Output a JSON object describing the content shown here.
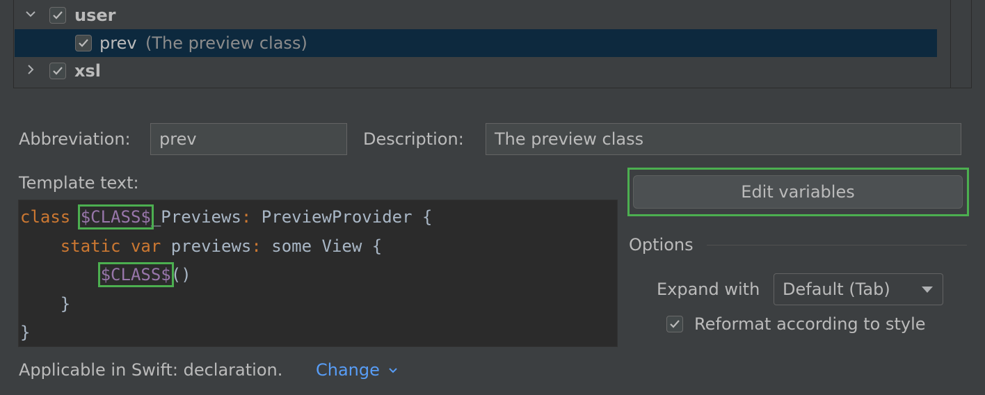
{
  "tree": {
    "rows": [
      {
        "label": "user",
        "checked": true,
        "expanded": true,
        "description": ""
      },
      {
        "label": "prev",
        "checked": true,
        "description": "(The preview class)",
        "selected": true
      },
      {
        "label": "xsl",
        "checked": true,
        "expanded": false,
        "description": ""
      }
    ]
  },
  "form": {
    "abbreviation_label": "Abbreviation:",
    "abbreviation_value": "prev",
    "description_label": "Description:",
    "description_value": "The preview class",
    "template_text_label": "Template text:"
  },
  "template": {
    "lines": [
      {
        "indent": "",
        "tokens": [
          [
            "kw",
            "class "
          ],
          [
            "var",
            "$CLASS$"
          ],
          [
            "plain",
            "_Previews"
          ],
          [
            "kw",
            ":"
          ],
          [
            "plain",
            " PreviewProvider {"
          ]
        ]
      },
      {
        "indent": "    ",
        "tokens": [
          [
            "kw",
            "static var "
          ],
          [
            "plain",
            "previews"
          ],
          [
            "kw",
            ":"
          ],
          [
            "plain",
            " some View {"
          ]
        ]
      },
      {
        "indent": "        ",
        "tokens": [
          [
            "var",
            "$CLASS$"
          ],
          [
            "plain",
            "()"
          ]
        ]
      },
      {
        "indent": "    ",
        "tokens": [
          [
            "plain",
            "}"
          ]
        ]
      },
      {
        "indent": "",
        "tokens": [
          [
            "plain",
            "}"
          ]
        ]
      }
    ]
  },
  "right_panel": {
    "edit_variables_label": "Edit variables",
    "options_label": "Options",
    "expand_with_label": "Expand with",
    "expand_with_value": "Default (Tab)",
    "reformat_label": "Reformat according to style",
    "reformat_checked": true
  },
  "footer": {
    "applicable_text": "Applicable in Swift: declaration.",
    "change_link": "Change"
  },
  "colors": {
    "highlight": "#4caf50",
    "keyword": "#cc7832",
    "variable": "#9876aa",
    "link": "#589df6",
    "selection": "#0d293e"
  }
}
